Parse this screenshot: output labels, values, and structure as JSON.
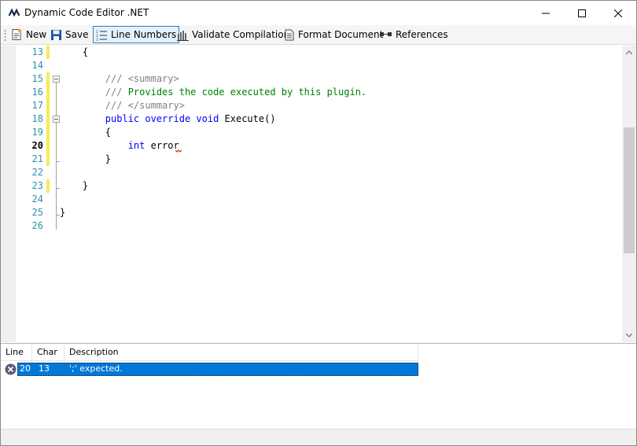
{
  "window": {
    "title": "Dynamic Code Editor .NET",
    "icons": {
      "app": "app-logo-icon",
      "minimize": "minimize-icon",
      "maximize": "maximize-icon",
      "close": "close-icon"
    }
  },
  "toolbar": {
    "new_label": "New",
    "save_label": "Save",
    "line_numbers_label": "Line Numbers",
    "line_numbers_active": true,
    "validate_label": "Validate Compilation",
    "format_label": "Format Document",
    "references_label": "References",
    "icons": [
      "new-document-icon",
      "save-icon",
      "line-numbers-icon",
      "validate-icon",
      "format-document-icon",
      "references-icon"
    ]
  },
  "editor": {
    "current_line": "20",
    "lines": [
      {
        "num": "13",
        "text": "    {"
      },
      {
        "num": "14",
        "text": ""
      },
      {
        "num": "15",
        "text": "        /// <summary>"
      },
      {
        "num": "16",
        "text": "        /// Provides the code executed by this plugin."
      },
      {
        "num": "17",
        "text": "        /// </summary>"
      },
      {
        "num": "18",
        "text": "        public override void Execute()"
      },
      {
        "num": "19",
        "text": "        {"
      },
      {
        "num": "20",
        "text": "            int error"
      },
      {
        "num": "21",
        "text": "        }"
      },
      {
        "num": "22",
        "text": ""
      },
      {
        "num": "23",
        "text": "    }"
      },
      {
        "num": "24",
        "text": ""
      },
      {
        "num": "25",
        "text": "}"
      },
      {
        "num": "26",
        "text": ""
      }
    ],
    "tokens": {
      "l15_a": "/// ",
      "l15_b": "<summary>",
      "l16_a": "/// ",
      "l16_b": "Provides the code executed by this plugin.",
      "l17_a": "/// ",
      "l17_b": "</summary>",
      "l18_kw": "public override void",
      "l18_rest": " Execute()",
      "l20_kw": "int",
      "l20_rest": " error"
    }
  },
  "errors": {
    "columns": [
      "Line",
      "Char",
      "Description"
    ],
    "rows": [
      {
        "line": "20",
        "char": "13",
        "description": "';' expected.",
        "icon": "error-icon",
        "selected": true
      }
    ]
  },
  "colors": {
    "selection": "#0078d7",
    "line_number": "#2b91af",
    "keyword": "#0000ff",
    "comment_text": "#008000",
    "xml_tag": "#808080",
    "change_marker": "#f7ea57"
  }
}
